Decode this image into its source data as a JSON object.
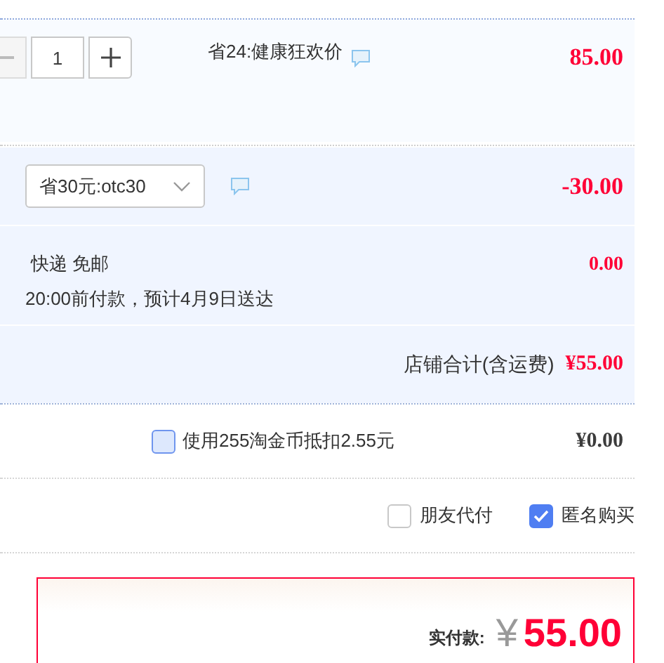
{
  "item": {
    "quantity": "1",
    "promo": "省24:健康狂欢价",
    "price": "85.00"
  },
  "coupon": {
    "value": "省30元:otc30",
    "amount": "-30.00"
  },
  "shipping": {
    "method": "快递 免邮",
    "fee": "0.00",
    "delivery": "20:00前付款，预计4月9日送达"
  },
  "store_total": {
    "label": "店铺合计(含运费)",
    "amount": "¥55.00"
  },
  "coins": {
    "label": "使用255淘金币抵扣2.55元",
    "checked": false,
    "amount": "¥0.00"
  },
  "options": [
    {
      "label": "朋友代付",
      "checked": false
    },
    {
      "label": "匿名购买",
      "checked": true
    }
  ],
  "payment": {
    "label": "实付款:",
    "currency": "¥",
    "amount": "55.00"
  }
}
